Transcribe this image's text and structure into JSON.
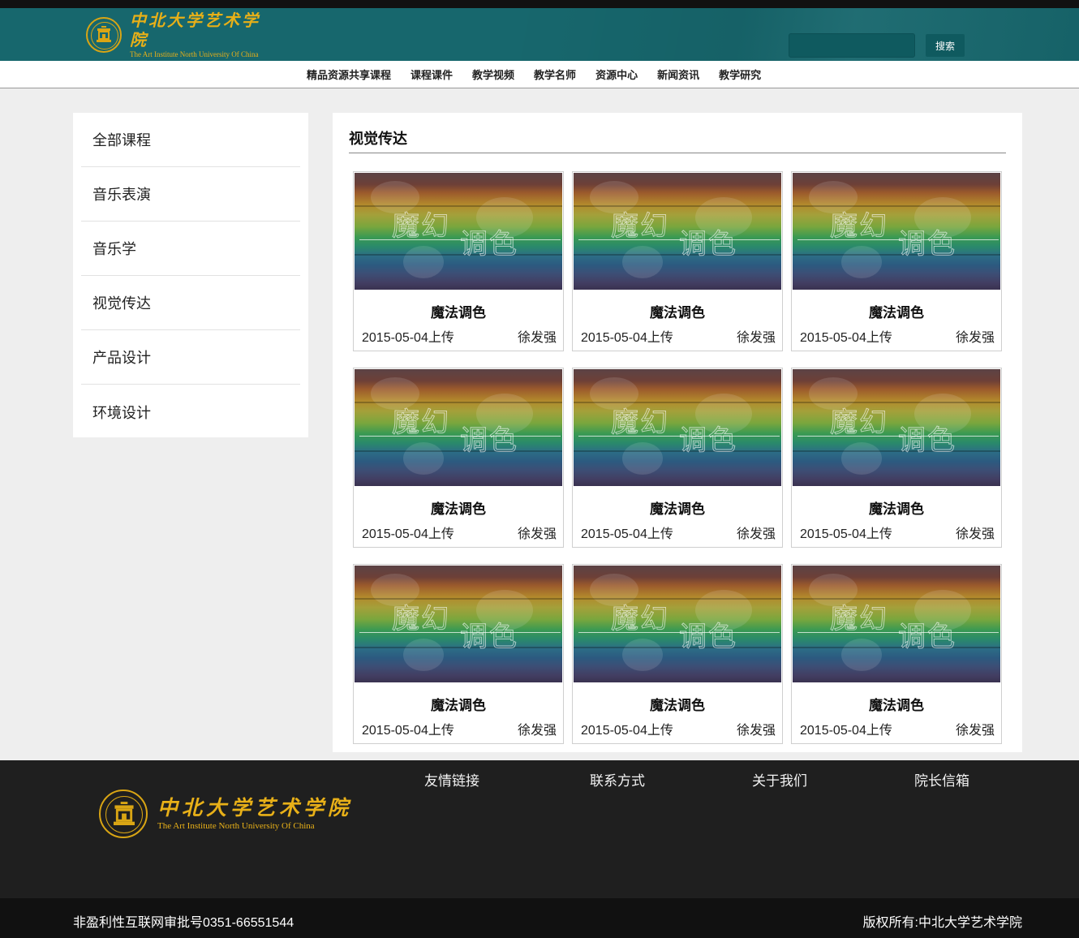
{
  "header": {
    "logo_cn": "中北大学艺术学院",
    "logo_en": "The Art Institute North University Of China",
    "search_placeholder": "",
    "search_button": "搜索",
    "bg_color": "#17676d",
    "accent_color": "#e8b018"
  },
  "nav": {
    "items": [
      "精品资源共享课程",
      "课程课件",
      "教学视频",
      "教学名师",
      "资源中心",
      "新闻资讯",
      "教学研究"
    ]
  },
  "sidebar": {
    "items": [
      "全部课程",
      "音乐表演",
      "音乐学",
      "视觉传达",
      "产品设计",
      "环境设计"
    ]
  },
  "main": {
    "section_title": "视觉传达",
    "thumbnail_text_1": "魔幻",
    "thumbnail_text_2": "调色",
    "cards": [
      {
        "title": "魔法调色",
        "date": "2015-05-04上传",
        "author": "徐发强"
      },
      {
        "title": "魔法调色",
        "date": "2015-05-04上传",
        "author": "徐发强"
      },
      {
        "title": "魔法调色",
        "date": "2015-05-04上传",
        "author": "徐发强"
      },
      {
        "title": "魔法调色",
        "date": "2015-05-04上传",
        "author": "徐发强"
      },
      {
        "title": "魔法调色",
        "date": "2015-05-04上传",
        "author": "徐发强"
      },
      {
        "title": "魔法调色",
        "date": "2015-05-04上传",
        "author": "徐发强"
      },
      {
        "title": "魔法调色",
        "date": "2015-05-04上传",
        "author": "徐发强"
      },
      {
        "title": "魔法调色",
        "date": "2015-05-04上传",
        "author": "徐发强"
      },
      {
        "title": "魔法调色",
        "date": "2015-05-04上传",
        "author": "徐发强"
      }
    ]
  },
  "footer": {
    "links": [
      "友情链接",
      "联系方式",
      "关于我们",
      "院长信箱"
    ],
    "license": "非盈利性互联网审批号0351-66551544",
    "copyright": "版权所有:中北大学艺术学院"
  }
}
